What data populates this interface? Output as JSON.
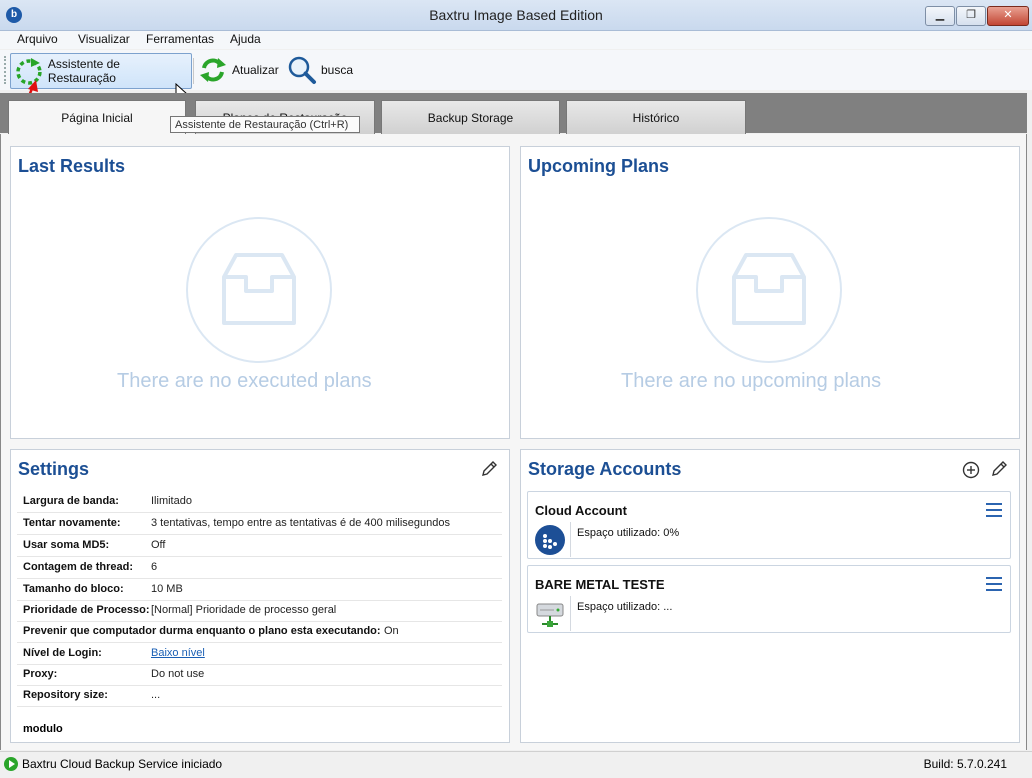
{
  "window": {
    "title": "Baxtru Image Based Edition",
    "minimize": "▁",
    "maximize": "❐",
    "close": "✕"
  },
  "menu": [
    "Arquivo",
    "Visualizar",
    "Ferramentas",
    "Ajuda"
  ],
  "toolbar": {
    "restore_wizard": "Assistente de Restauração",
    "refresh": "Atualizar",
    "search": "busca",
    "tooltip": "Assistente de Restauração (Ctrl+R)"
  },
  "tabs": [
    "Página Inicial",
    "Planos de Restauração",
    "Backup Storage",
    "Histórico"
  ],
  "last_results": {
    "title": "Last Results",
    "empty": "There are no executed plans"
  },
  "upcoming_plans": {
    "title": "Upcoming Plans",
    "empty": "There are no upcoming plans"
  },
  "settings": {
    "title": "Settings",
    "rows": [
      {
        "key": "Largura de banda:",
        "value": "Ilimitado"
      },
      {
        "key": "Tentar novamente:",
        "value": "3  tentativas, tempo entre as tentativas é de 400 milisegundos"
      },
      {
        "key": "Usar soma MD5:",
        "value": "Off"
      },
      {
        "key": "Contagem de thread:",
        "value": "6"
      },
      {
        "key": "Tamanho do bloco:",
        "value": "10 MB"
      },
      {
        "key": "Prioridade de Processo:",
        "value": "[Normal] Prioridade de processo geral"
      },
      {
        "key": "Prevenir que computador durma enquanto o plano esta executando:",
        "value": "On"
      },
      {
        "key": "Nível de Login:",
        "value": "Baixo nível"
      },
      {
        "key": "Proxy:",
        "value": "Do not use"
      },
      {
        "key": "Repository size:",
        "value": "..."
      }
    ],
    "module": "modulo"
  },
  "storage": {
    "title": "Storage Accounts",
    "accounts": [
      {
        "name": "Cloud Account",
        "usage": "Espaço utilizado: 0%"
      },
      {
        "name": "BARE METAL TESTE",
        "usage": "Espaço utilizado: ..."
      }
    ]
  },
  "status": {
    "message": "Baxtru Cloud Backup Service iniciado",
    "build": "Build: 5.7.0.241"
  }
}
